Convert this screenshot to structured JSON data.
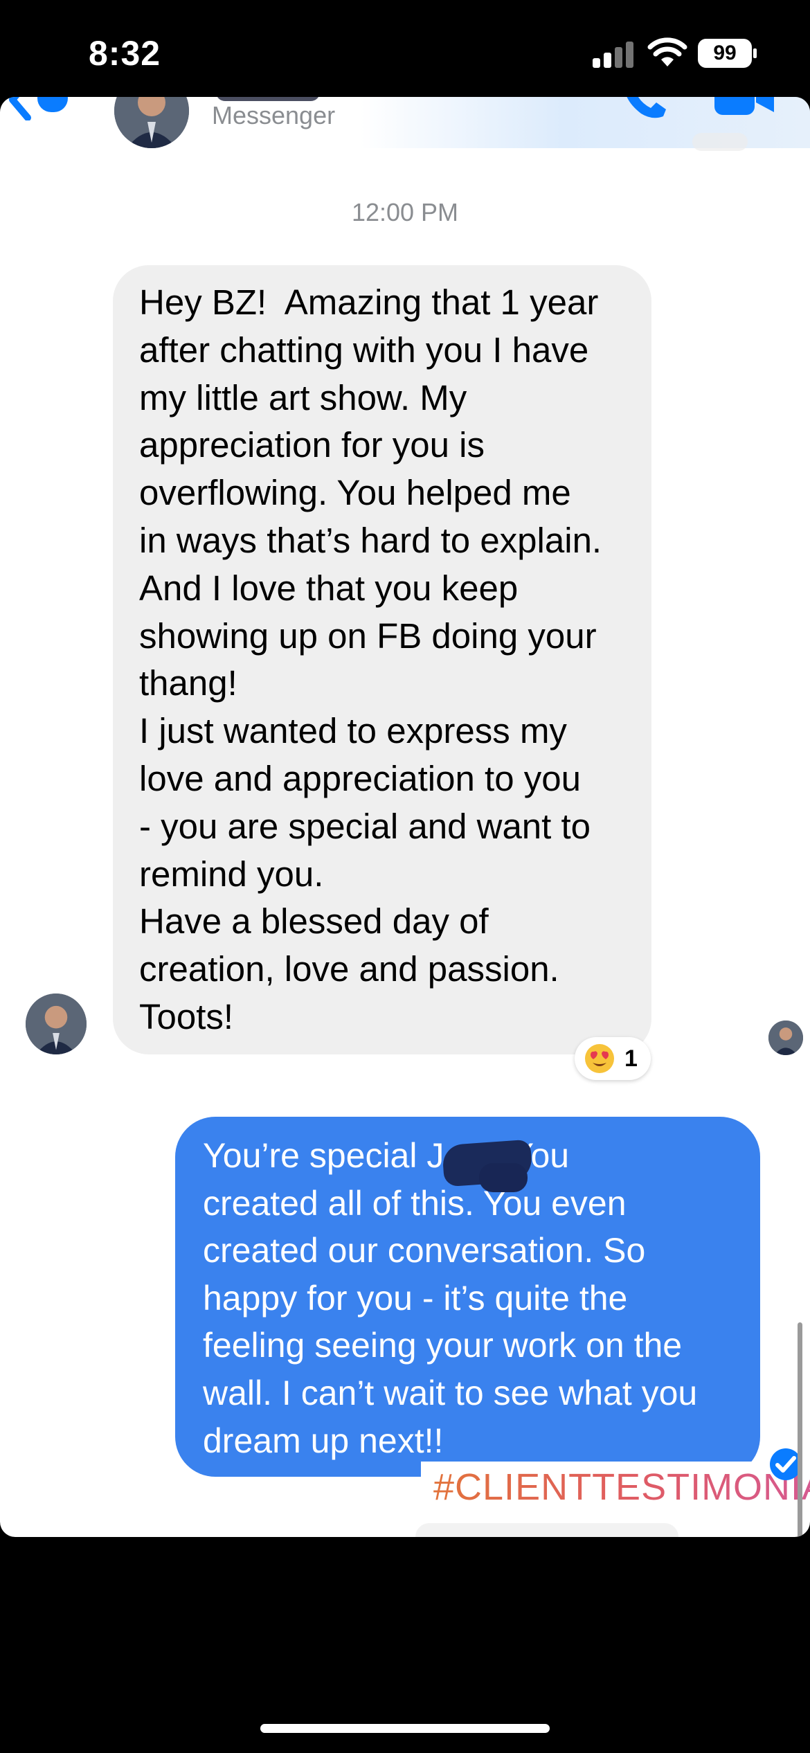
{
  "status_bar": {
    "time": "8:32",
    "battery": "99"
  },
  "header": {
    "subtitle": "Messenger"
  },
  "conversation": {
    "timestamp": "12:00 PM",
    "incoming": {
      "text": "Hey BZ!  Amazing that 1 year\nafter chatting with you I have\nmy little art show. My\nappreciation for you is\noverflowing. You helped me\nin ways that’s hard to explain.\nAnd I love that you keep\nshowing up on FB doing your\nthang!\nI just wanted to express my\nlove and appreciation to you\n- you are special and want to\nremind you.\nHave a blessed day of\ncreation, love and passion.\nToots!",
      "reaction": {
        "emoji": "heart-eyes-emoji",
        "count": "1"
      }
    },
    "outgoing": {
      "text": "You’re special J       You\ncreated all of this. You even\ncreated our conversation. So\nhappy for you - it’s quite the\nfeeling seeing your work on the\nwall. I can’t wait to see what you\ndream up next!!"
    }
  },
  "overlay": {
    "hashtag": "#CLIENTTESTIMONIAL"
  },
  "colors": {
    "outgoing_bubble": "#3a82ee",
    "incoming_bubble": "#efefef",
    "accent": "#0a7cff"
  }
}
